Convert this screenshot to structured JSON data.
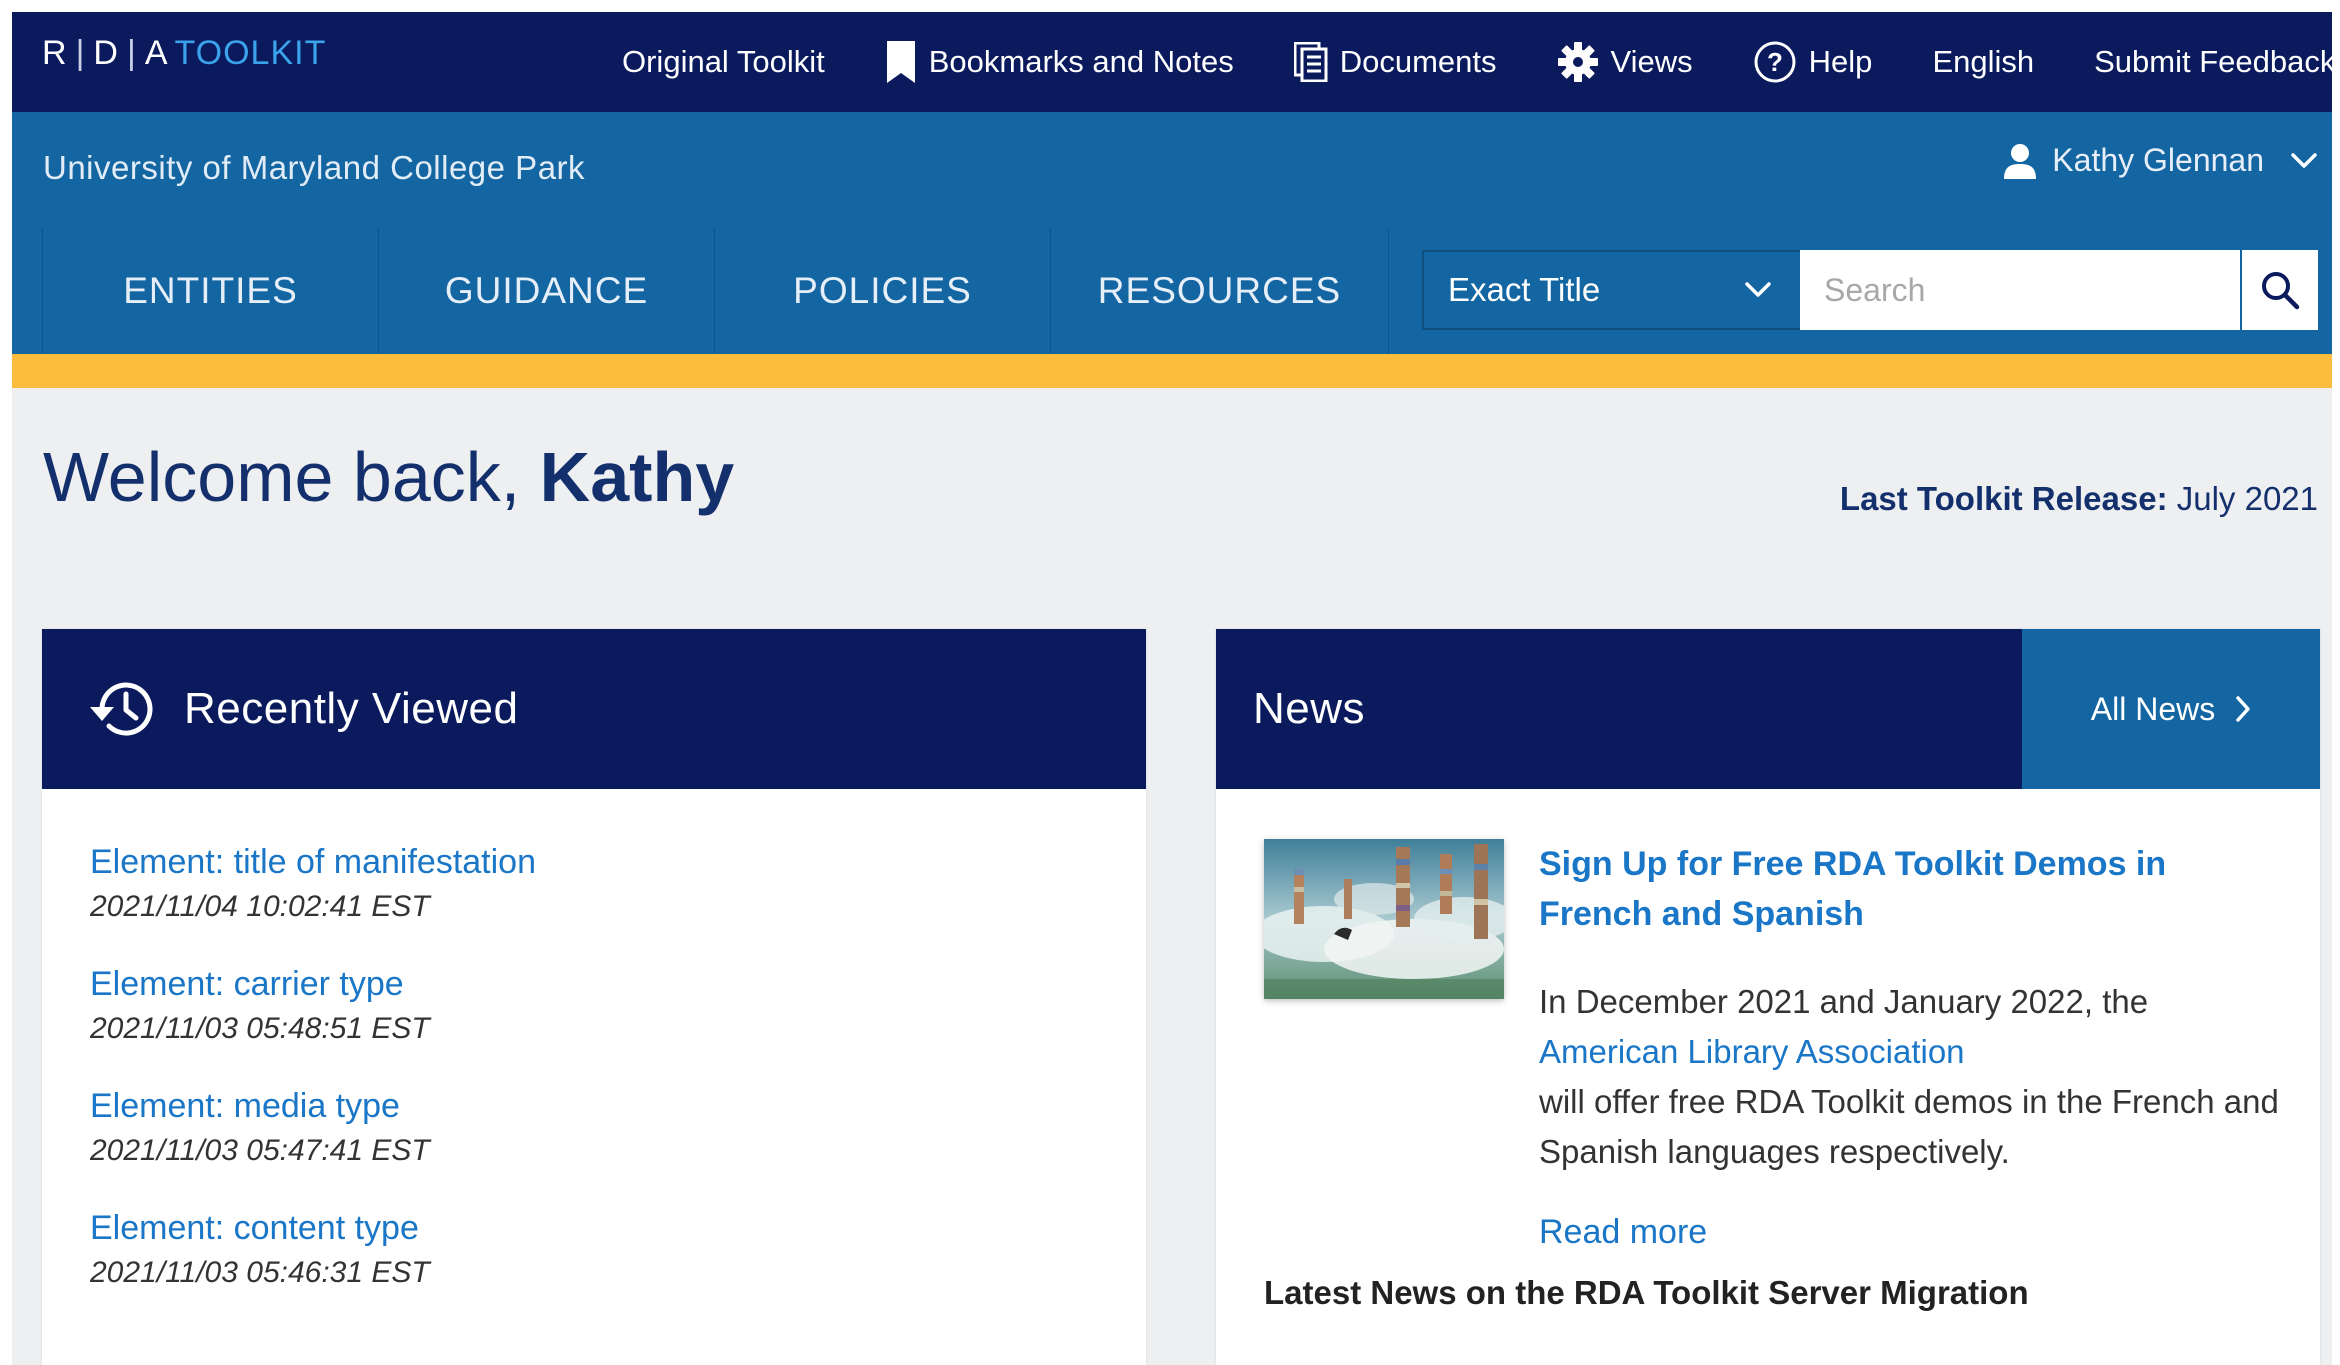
{
  "logo": {
    "r": "R",
    "d": "D",
    "a": "A",
    "toolkit": "TOOLKIT"
  },
  "topnav": [
    {
      "label": "Original Toolkit",
      "icon": "none"
    },
    {
      "label": "Bookmarks and Notes",
      "icon": "bookmark-icon"
    },
    {
      "label": "Documents",
      "icon": "documents-icon"
    },
    {
      "label": "Views",
      "icon": "gear-icon"
    },
    {
      "label": "Help",
      "icon": "help-icon"
    },
    {
      "label": "English",
      "icon": "none"
    },
    {
      "label": "Submit Feedback",
      "icon": "none"
    }
  ],
  "institution": "University of Maryland College Park",
  "user": {
    "name": "Kathy Glennan"
  },
  "mainnav": [
    "ENTITIES",
    "GUIDANCE",
    "POLICIES",
    "RESOURCES"
  ],
  "search": {
    "mode": "Exact Title",
    "placeholder": "Search"
  },
  "welcome": {
    "prefix": "Welcome back,",
    "name": "Kathy"
  },
  "release": {
    "label": "Last Toolkit Release:",
    "value": "July 2021"
  },
  "recently_viewed": {
    "title": "Recently Viewed",
    "items": [
      {
        "title": "Element: title of manifestation",
        "time": "2021/11/04 10:02:41 EST"
      },
      {
        "title": "Element: carrier type",
        "time": "2021/11/03 05:48:51 EST"
      },
      {
        "title": "Element: media type",
        "time": "2021/11/03 05:47:41 EST"
      },
      {
        "title": "Element: content type",
        "time": "2021/11/03 05:46:31 EST"
      }
    ]
  },
  "news": {
    "title": "News",
    "all_label": "All News",
    "headline": "Sign Up for Free RDA Toolkit Demos in French and Spanish",
    "text_before": "In December 2021 and January 2022, the",
    "link": "American Library Association",
    "text_after": "will offer free RDA Toolkit demos in the French and Spanish languages respectively.",
    "read_more": "Read more",
    "latest": "Latest News on the RDA Toolkit Server Migration"
  },
  "colors": {
    "navy": "#0a1a5c",
    "blue": "#1466a3",
    "accent": "#fbbd3b",
    "link": "#1a76c7"
  }
}
